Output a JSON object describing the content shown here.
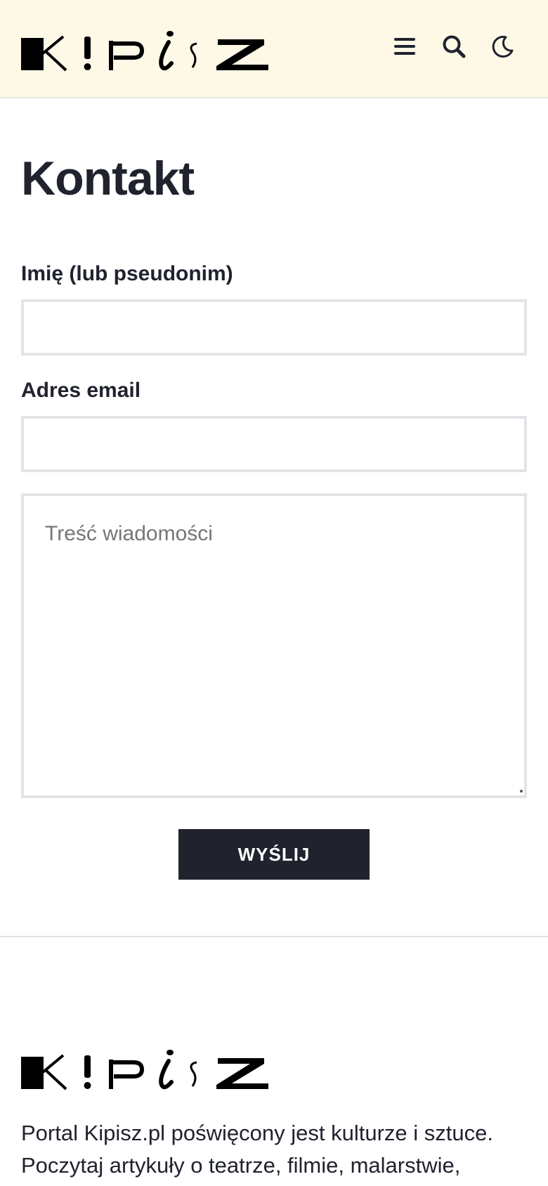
{
  "brand": {
    "logo_text": "KIPISZ",
    "header_bg": "#fdf9e6",
    "ink": "#20232e"
  },
  "header": {
    "menu_icon": "menu-icon",
    "search_icon": "search-icon",
    "dark_mode_icon": "moon-icon"
  },
  "page": {
    "title": "Kontakt"
  },
  "form": {
    "name_label": "Imię (lub pseudonim)",
    "name_value": "",
    "email_label": "Adres email",
    "email_value": "",
    "message_placeholder": "Treść wiadomości",
    "message_value": "",
    "submit_label": "WYŚLIJ"
  },
  "footer": {
    "logo_text": "KIPISZ",
    "description": "Portal Kipisz.pl poświęcony jest kulturze i sztuce. Poczytaj artykuły o teatrze, filmie, malarstwie,"
  }
}
